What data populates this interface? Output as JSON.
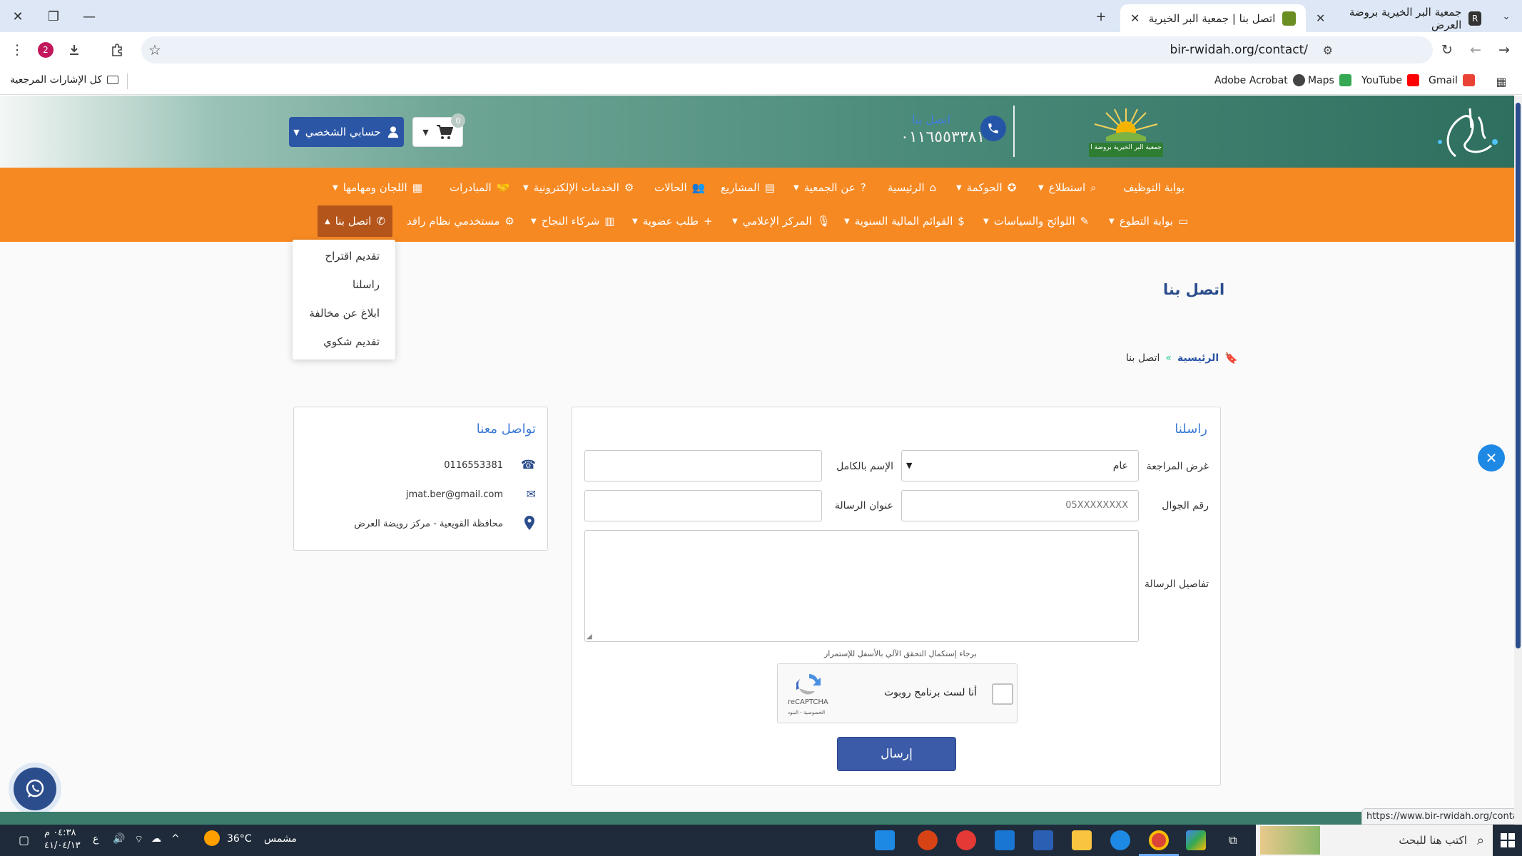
{
  "browser": {
    "tabs": [
      {
        "title": "جمعية البر الخيرية بروضة العرض",
        "active": false
      },
      {
        "title": "اتصل بنا | جمعية البر الخيرية برو...",
        "active": true
      }
    ],
    "url": "bir-rwidah.org/contact/",
    "profile_badge": "2",
    "bookmarks": [
      {
        "label": "Gmail",
        "color": "#ea4335"
      },
      {
        "label": "YouTube",
        "color": "#ff0000"
      },
      {
        "label": "Maps",
        "color": "#34a853"
      },
      {
        "label": "Adobe Acrobat",
        "color": "#444444"
      }
    ],
    "all_bookmarks": "كل الإشارات المرجعية",
    "status_url": "https://www.bir-rwidah.org/contact/"
  },
  "header": {
    "logo_text": "جمعية البر الخيرية بروضة العرض",
    "call_word": "اتصل بنا",
    "phone": "٠١١٦٥٥٣٣٨١",
    "account_label": "حسابي الشخصي",
    "cart_count": "0"
  },
  "nav": {
    "row1": [
      {
        "label": "بوابة التوظيف",
        "dropdown": false
      },
      {
        "label": "استطلاع",
        "dropdown": true
      },
      {
        "label": "الحوكمة",
        "dropdown": true
      },
      {
        "label": "الرئيسية",
        "dropdown": false
      },
      {
        "label": "عن الجمعية",
        "dropdown": true
      },
      {
        "label": "المشاريع",
        "dropdown": false
      },
      {
        "label": "الحالات",
        "dropdown": false
      },
      {
        "label": "الخدمات الإلكترونية",
        "dropdown": true
      },
      {
        "label": "المبادرات",
        "dropdown": false
      },
      {
        "label": "اللجان ومهامها",
        "dropdown": true
      }
    ],
    "row2": [
      {
        "label": "بوابة التطوع",
        "dropdown": true
      },
      {
        "label": "اللوائح والسياسات",
        "dropdown": true
      },
      {
        "label": "القوائم المالية السنوية",
        "dropdown": true
      },
      {
        "label": "المركز الإعلامي",
        "dropdown": true
      },
      {
        "label": "طلب عضوية",
        "dropdown": true
      },
      {
        "label": "شركاء النجاح",
        "dropdown": true
      },
      {
        "label": "مستخدمي نظام رافد",
        "dropdown": false
      },
      {
        "label": "اتصل بنا",
        "dropdown": true
      }
    ],
    "contact_dropdown": [
      "تقديم اقتراح",
      "راسلنا",
      "ابلاغ عن مخالفة",
      "تقديم شكوي"
    ]
  },
  "page": {
    "title": "اتصل بنا",
    "breadcrumb_home": "الرئيسية",
    "breadcrumb_sep": "»",
    "breadcrumb_current": "اتصل بنا"
  },
  "form": {
    "title": "راسلنا",
    "purpose_label": "غرض المراجعة",
    "purpose_value": "عام",
    "name_label": "الإسم بالكامل",
    "mobile_label": "رقم الجوال",
    "mobile_placeholder": "05XXXXXXXX",
    "subject_label": "عنوان الرسالة",
    "details_label": "تفاصيل الرسالة",
    "captcha_note": "برجاء إستكمال التحقق الآلي بالأسفل للإستمرار",
    "captcha_label": "أنا لست برنامج روبوت",
    "captcha_brand": "reCAPTCHA",
    "captcha_links": "الخصوصية - البنود",
    "submit_label": "إرسال"
  },
  "contact": {
    "title": "تواصل معنا",
    "phone": "0116553381",
    "email": "jmat.ber@gmail.com",
    "address": "محافظة القويعية - مركز رويضة العرض"
  },
  "taskbar": {
    "search_placeholder": "اكتب هنا للبحث",
    "weather_temp": "36°C",
    "weather_desc": "مشمس",
    "lang": "ع",
    "time": "٠٤:٣٨ م",
    "date": "٤١/٠٤/١٣"
  },
  "colors": {
    "nav_orange": "#f78923",
    "nav_active": "#b4551b",
    "primary_blue": "#2b56a6",
    "header_green": "#3b7c6c"
  }
}
